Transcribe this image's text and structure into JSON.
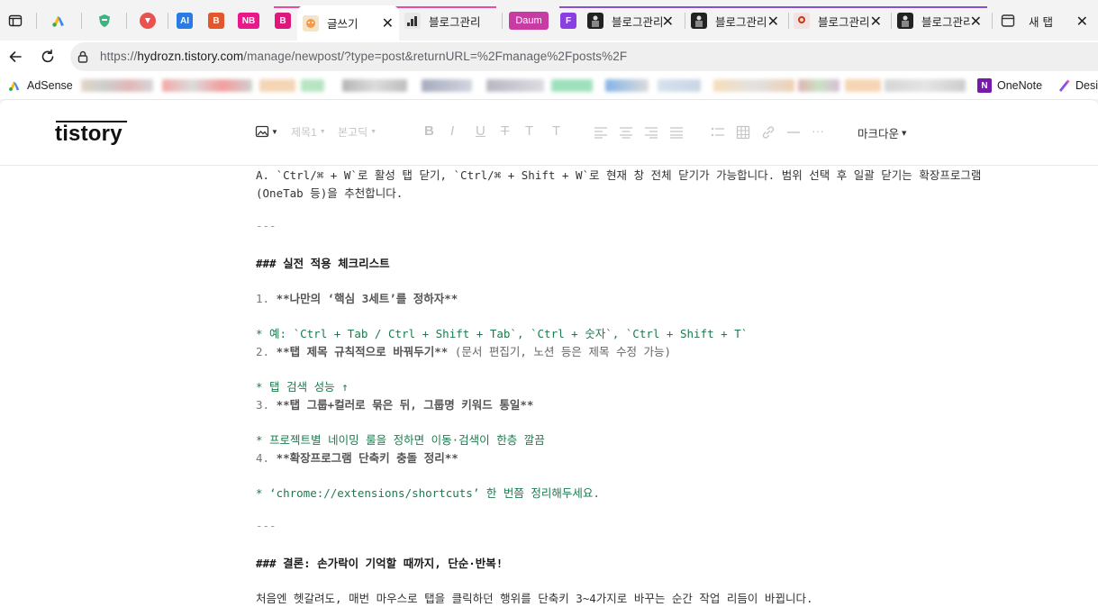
{
  "browser": {
    "tabs": [
      {
        "label": "",
        "icon": "adsense-icon"
      },
      {
        "label": "",
        "icon": "shield-icon"
      },
      {
        "label": "",
        "icon": "extension-icon"
      },
      {
        "label": "AI",
        "icon": "ai-icon"
      },
      {
        "label": "B",
        "icon": "b-icon"
      },
      {
        "label": "NB",
        "icon": "nb-icon"
      },
      {
        "label": "B",
        "icon": "b-pink-icon"
      },
      {
        "label": "글쓰기",
        "icon": "tistory-icon"
      },
      {
        "label": "블로그관리",
        "icon": "chart-icon"
      },
      {
        "label": "Daum",
        "icon": "daum-icon"
      },
      {
        "label": "F",
        "icon": "f-icon"
      },
      {
        "label": "블로그관리",
        "icon": "avatar-icon"
      },
      {
        "label": "블로그관리",
        "icon": "avatar-icon"
      },
      {
        "label": "블로그관리",
        "icon": "avatar-icon"
      },
      {
        "label": "블로그관리",
        "icon": "avatar-icon"
      },
      {
        "label": "새 탭",
        "icon": "new-tab-page-icon"
      }
    ],
    "url_prefix": "https://",
    "url_host": "hydrozn.tistory.com",
    "url_path": "/manage/newpost/?type=post&returnURL=%2Fmanage%2Fposts%2F",
    "bookmarks": {
      "adsense": "AdSense",
      "onenote": "OneNote",
      "designer": "Desig"
    }
  },
  "editor": {
    "logo": "tistory",
    "toolbar": {
      "heading": "제목1",
      "font": "본고딕",
      "bold": "B",
      "italic": "I",
      "underline": "U",
      "strike": "T",
      "text_color": "T",
      "bg_color": "T",
      "more": "···",
      "mode": "마크다운"
    },
    "lines": [
      "A. `Ctrl/⌘ + W`로 활성 탭 닫기, `Ctrl/⌘ + Shift + W`로 현재 창 전체 닫기가 가능합니다. 범위 선택 후 일괄 닫기는 확장프로그램",
      "(OneTab 등)을 추천합니다.",
      "---",
      "### 실전 적용 체크리스트",
      "1. ",
      "**나만의 ‘핵심 3세트’를 정하자**",
      "   * 예: `Ctrl + Tab / Ctrl + Shift + Tab`, `Ctrl + 숫자`, `Ctrl + Shift + T`",
      "2. ",
      "**탭 제목 규칙적으로 바꿔두기**",
      " (문서 편집기, 노션 등은 제목 수정 가능)",
      "   * 탭 검색 성능 ↑",
      "3. ",
      "**탭 그룹+컬러로 묶은 뒤, 그룹명 키워드 통일**",
      "   * 프로젝트별 네이밍 룰을 정하면 이동·검색이 한층 깔끔",
      "4. ",
      "**확장프로그램 단축키 충돌 정리**",
      "   * ‘chrome://extensions/shortcuts’ 한 번쯤 정리해두세요.",
      "---",
      "### 결론: 손가락이 기억할 때까지, 단순·반복!",
      "처음엔 헷갈려도, 매번 마우스로 탭을 클릭하던 행위를 단축키 3~4가지로 바꾸는 순간 작업 리듬이 바뀝니다."
    ]
  }
}
